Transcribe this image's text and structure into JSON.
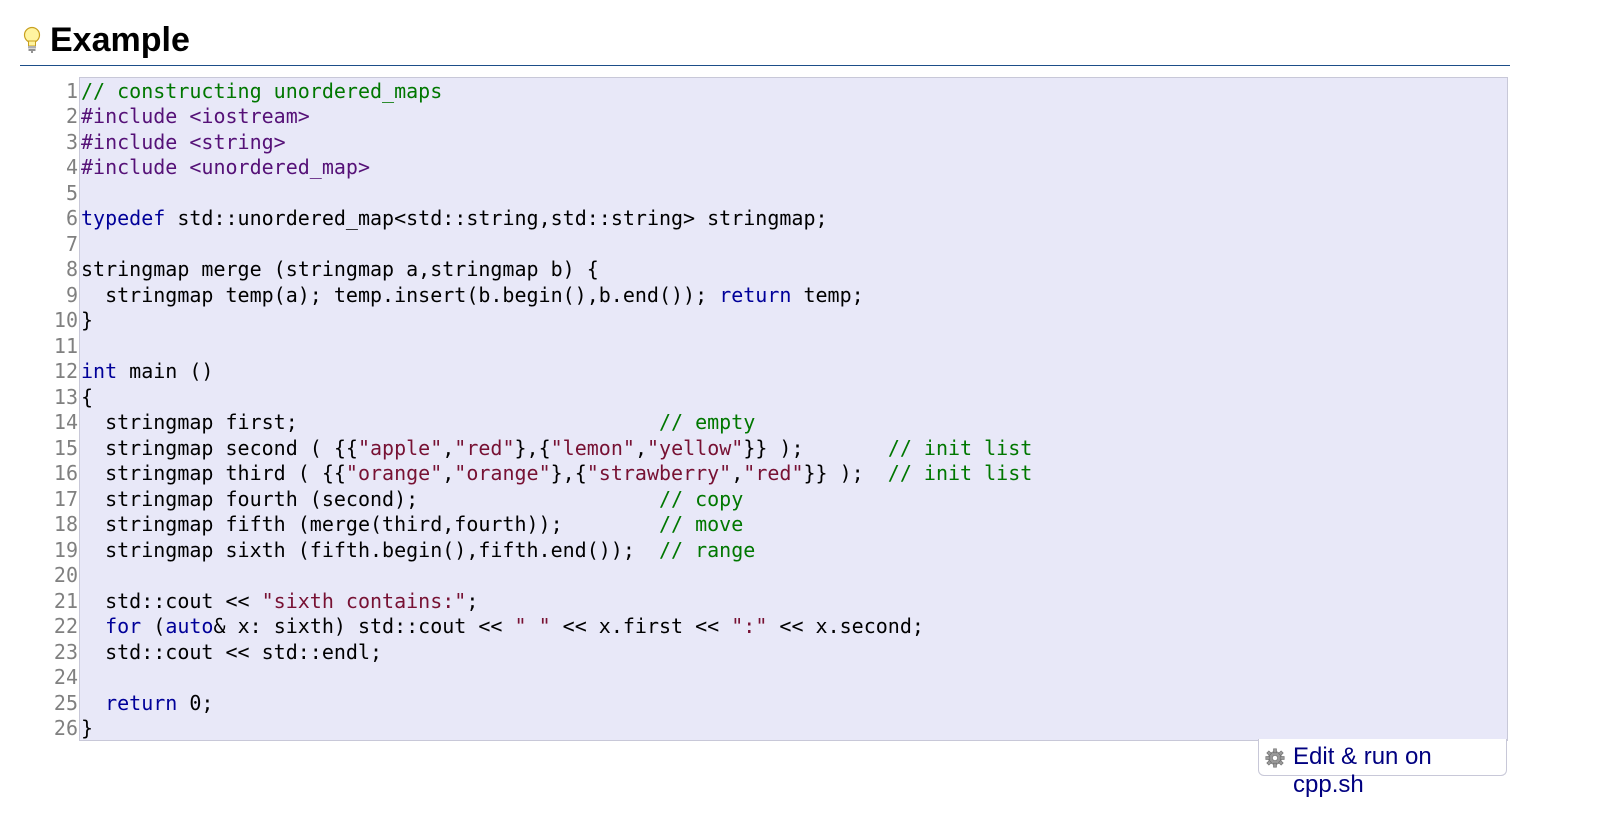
{
  "header": {
    "title": "Example",
    "icon": "lightbulb-icon"
  },
  "code": {
    "line_numbers": [
      "1",
      "2",
      "3",
      "4",
      "5",
      "6",
      "7",
      "8",
      "9",
      "10",
      "11",
      "12",
      "13",
      "14",
      "15",
      "16",
      "17",
      "18",
      "19",
      "20",
      "21",
      "22",
      "23",
      "24",
      "25",
      "26"
    ],
    "lines": [
      [
        {
          "t": "c",
          "v": "// constructing unordered_maps"
        }
      ],
      [
        {
          "t": "pp",
          "v": "#include <iostream>"
        }
      ],
      [
        {
          "t": "pp",
          "v": "#include <string>"
        }
      ],
      [
        {
          "t": "pp",
          "v": "#include <unordered_map>"
        }
      ],
      [],
      [
        {
          "t": "k",
          "v": "typedef"
        },
        {
          "t": "p",
          "v": " std::unordered_map<std::string,std::string> stringmap;"
        }
      ],
      [],
      [
        {
          "t": "p",
          "v": "stringmap merge (stringmap a,stringmap b) {"
        }
      ],
      [
        {
          "t": "p",
          "v": "  stringmap temp(a); temp.insert(b.begin(),b.end()); "
        },
        {
          "t": "k",
          "v": "return"
        },
        {
          "t": "p",
          "v": " temp;"
        }
      ],
      [
        {
          "t": "p",
          "v": "}"
        }
      ],
      [],
      [
        {
          "t": "k",
          "v": "int"
        },
        {
          "t": "p",
          "v": " main ()"
        }
      ],
      [
        {
          "t": "p",
          "v": "{"
        }
      ],
      [
        {
          "t": "p",
          "v": "  stringmap first;                              "
        },
        {
          "t": "c",
          "v": "// empty"
        }
      ],
      [
        {
          "t": "p",
          "v": "  stringmap second ( {{"
        },
        {
          "t": "s",
          "v": "\"apple\""
        },
        {
          "t": "p",
          "v": ","
        },
        {
          "t": "s",
          "v": "\"red\""
        },
        {
          "t": "p",
          "v": "},{"
        },
        {
          "t": "s",
          "v": "\"lemon\""
        },
        {
          "t": "p",
          "v": ","
        },
        {
          "t": "s",
          "v": "\"yellow\""
        },
        {
          "t": "p",
          "v": "}} );       "
        },
        {
          "t": "c",
          "v": "// init list"
        }
      ],
      [
        {
          "t": "p",
          "v": "  stringmap third ( {{"
        },
        {
          "t": "s",
          "v": "\"orange\""
        },
        {
          "t": "p",
          "v": ","
        },
        {
          "t": "s",
          "v": "\"orange\""
        },
        {
          "t": "p",
          "v": "},{"
        },
        {
          "t": "s",
          "v": "\"strawberry\""
        },
        {
          "t": "p",
          "v": ","
        },
        {
          "t": "s",
          "v": "\"red\""
        },
        {
          "t": "p",
          "v": "}} );  "
        },
        {
          "t": "c",
          "v": "// init list"
        }
      ],
      [
        {
          "t": "p",
          "v": "  stringmap fourth (second);                    "
        },
        {
          "t": "c",
          "v": "// copy"
        }
      ],
      [
        {
          "t": "p",
          "v": "  stringmap fifth (merge(third,fourth));        "
        },
        {
          "t": "c",
          "v": "// move"
        }
      ],
      [
        {
          "t": "p",
          "v": "  stringmap sixth (fifth.begin(),fifth.end());  "
        },
        {
          "t": "c",
          "v": "// range"
        }
      ],
      [],
      [
        {
          "t": "p",
          "v": "  std::cout << "
        },
        {
          "t": "s",
          "v": "\"sixth contains:\""
        },
        {
          "t": "p",
          "v": ";"
        }
      ],
      [
        {
          "t": "p",
          "v": "  "
        },
        {
          "t": "k",
          "v": "for"
        },
        {
          "t": "p",
          "v": " ("
        },
        {
          "t": "k",
          "v": "auto"
        },
        {
          "t": "p",
          "v": "& x: sixth) std::cout << "
        },
        {
          "t": "s",
          "v": "\" \""
        },
        {
          "t": "p",
          "v": " << x.first << "
        },
        {
          "t": "s",
          "v": "\":\""
        },
        {
          "t": "p",
          "v": " << x.second;"
        }
      ],
      [
        {
          "t": "p",
          "v": "  std::cout << std::endl;"
        }
      ],
      [],
      [
        {
          "t": "p",
          "v": "  "
        },
        {
          "t": "k",
          "v": "return"
        },
        {
          "t": "p",
          "v": " 0;"
        }
      ],
      [
        {
          "t": "p",
          "v": "}"
        }
      ]
    ]
  },
  "run_button": {
    "label": "Edit & run on cpp.sh",
    "icon": "gear-icon"
  }
}
